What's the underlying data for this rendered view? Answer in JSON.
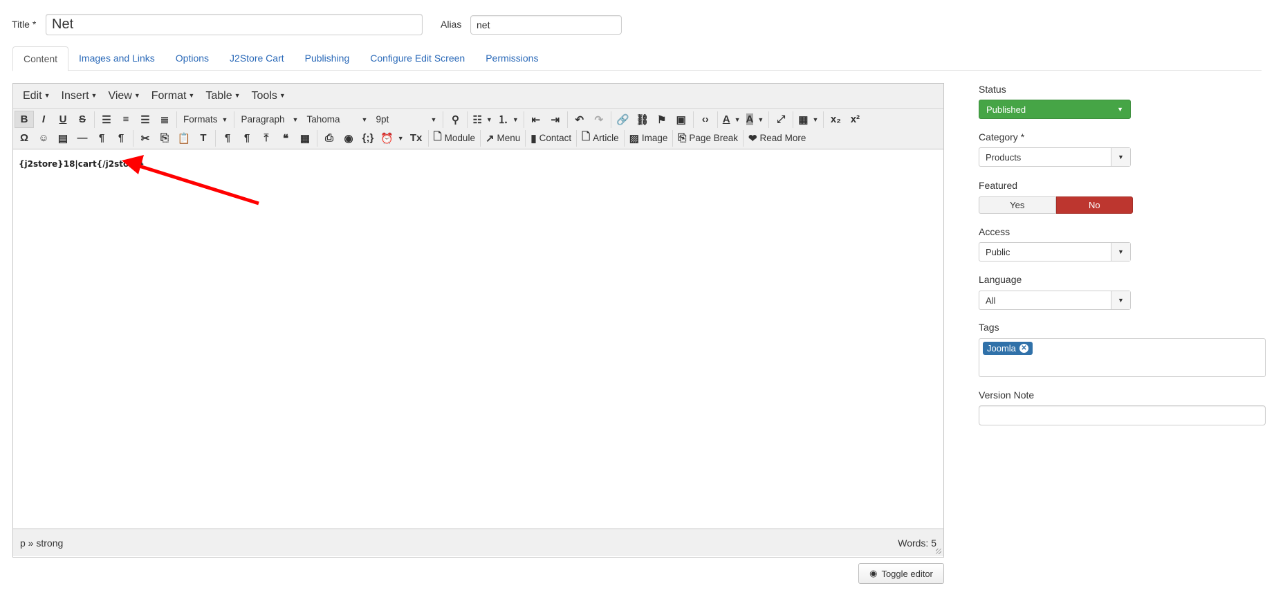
{
  "title": {
    "label": "Title *",
    "value": "Net"
  },
  "alias": {
    "label": "Alias",
    "value": "net"
  },
  "tabs": [
    "Content",
    "Images and Links",
    "Options",
    "J2Store Cart",
    "Publishing",
    "Configure Edit Screen",
    "Permissions"
  ],
  "editor": {
    "menus": [
      "Edit",
      "Insert",
      "View",
      "Format",
      "Table",
      "Tools"
    ],
    "toolbar_row1": [
      {
        "icon": "bold-icon",
        "active": true
      },
      {
        "icon": "italic-icon"
      },
      {
        "icon": "underline-icon"
      },
      {
        "icon": "strikethrough-icon"
      },
      {
        "sep": true
      },
      {
        "icon": "align-left-icon"
      },
      {
        "icon": "align-center-icon"
      },
      {
        "icon": "align-right-icon"
      },
      {
        "icon": "align-justify-icon"
      },
      {
        "sep": true
      },
      {
        "select": "Formats",
        "name": "formats-dropdown"
      },
      {
        "sep": true
      },
      {
        "select": "Paragraph",
        "name": "block-format-select",
        "wide": 95
      },
      {
        "select": "Tahoma",
        "name": "font-family-select",
        "wide": 100
      },
      {
        "select": "9pt",
        "name": "font-size-select",
        "wide": 100
      },
      {
        "sep": true
      },
      {
        "icon": "find-replace-icon"
      },
      {
        "sep": true
      },
      {
        "icon": "bullet-list-icon",
        "drop": true
      },
      {
        "icon": "numbered-list-icon",
        "drop": true
      },
      {
        "sep": true
      },
      {
        "icon": "outdent-icon"
      },
      {
        "icon": "indent-icon"
      },
      {
        "sep": true
      },
      {
        "icon": "undo-icon"
      },
      {
        "icon": "redo-icon"
      },
      {
        "sep": true
      },
      {
        "icon": "link-icon"
      },
      {
        "icon": "unlink-icon"
      },
      {
        "icon": "anchor-icon"
      },
      {
        "icon": "image-icon"
      },
      {
        "sep": true
      },
      {
        "icon": "source-code-icon"
      },
      {
        "sep": true
      },
      {
        "icon": "text-color-icon",
        "drop": true
      },
      {
        "icon": "background-color-icon",
        "drop": true
      },
      {
        "sep": true
      },
      {
        "icon": "fullscreen-icon"
      },
      {
        "sep": true
      },
      {
        "icon": "table-icon",
        "drop": true
      },
      {
        "sep": true
      },
      {
        "icon": "subscript-icon"
      },
      {
        "icon": "superscript-icon"
      }
    ],
    "toolbar_row2": [
      {
        "icon": "special-character-icon"
      },
      {
        "icon": "emoticons-icon"
      },
      {
        "icon": "media-icon"
      },
      {
        "icon": "horizontal-rule-icon"
      },
      {
        "icon": "left-to-right-icon"
      },
      {
        "icon": "right-to-left-icon"
      },
      {
        "sep": true
      },
      {
        "icon": "cut-icon"
      },
      {
        "icon": "copy-icon"
      },
      {
        "icon": "paste-icon"
      },
      {
        "icon": "paste-text-icon"
      },
      {
        "sep": true
      },
      {
        "icon": "show-invisible-icon"
      },
      {
        "icon": "show-blocks-icon"
      },
      {
        "icon": "upload-icon"
      },
      {
        "icon": "blockquote-icon"
      },
      {
        "icon": "template-icon"
      },
      {
        "sep": true
      },
      {
        "icon": "print-icon"
      },
      {
        "icon": "preview-icon"
      },
      {
        "icon": "code-sample-icon"
      },
      {
        "icon": "insert-datetime-icon",
        "drop": true
      },
      {
        "icon": "clear-formatting-icon"
      },
      {
        "sep": true
      },
      {
        "icon": "module-icon",
        "label": "Module"
      },
      {
        "sep": true
      },
      {
        "icon": "menu-icon",
        "label": "Menu"
      },
      {
        "sep": true
      },
      {
        "icon": "contact-icon",
        "label": "Contact"
      },
      {
        "sep": true
      },
      {
        "icon": "article-icon",
        "label": "Article"
      },
      {
        "sep": true
      },
      {
        "icon": "image-button-icon",
        "label": "Image"
      },
      {
        "sep": true
      },
      {
        "icon": "page-break-icon",
        "label": "Page Break"
      },
      {
        "sep": true
      },
      {
        "icon": "read-more-icon",
        "label": "Read More"
      }
    ],
    "content": "{j2store}18|cart{/j2store}",
    "path": "p » strong",
    "word_count": "Words: 5"
  },
  "toggle_editor": "Toggle editor",
  "sidebar": {
    "status": {
      "label": "Status",
      "value": "Published"
    },
    "category": {
      "label": "Category *",
      "value": "Products"
    },
    "featured": {
      "label": "Featured",
      "yes": "Yes",
      "no": "No",
      "selected": "No"
    },
    "access": {
      "label": "Access",
      "value": "Public"
    },
    "language": {
      "label": "Language",
      "value": "All"
    },
    "tags": {
      "label": "Tags",
      "items": [
        "Joomla"
      ]
    },
    "version_note": {
      "label": "Version Note",
      "value": ""
    }
  },
  "colors": {
    "published": "#46a546",
    "featured_no": "#bd362f",
    "tag": "#3071a9",
    "link": "#2a69b8",
    "arrow": "#ff0000"
  }
}
